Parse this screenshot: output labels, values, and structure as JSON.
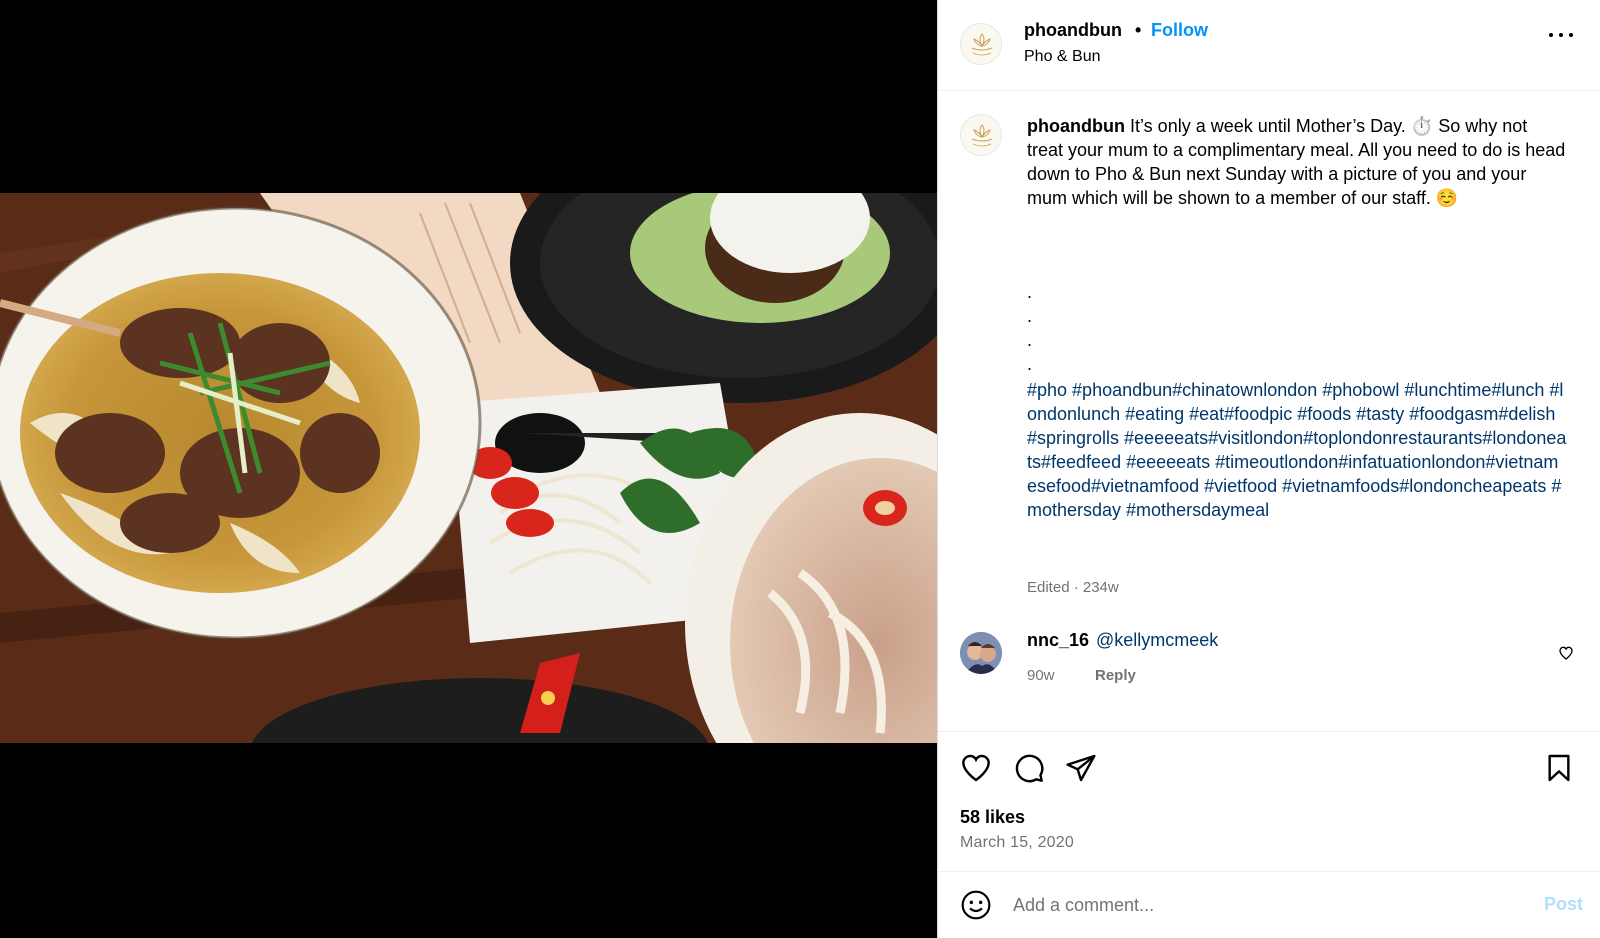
{
  "post": {
    "username": "phoandbun",
    "dot": "•",
    "follow_label": "Follow",
    "location": "Pho & Bun",
    "more_icon": "more-horizontal-icon"
  },
  "caption": {
    "username": "phoandbun",
    "text": "It’s only a week until Mother’s Day. ⏱️ So why not treat your mum to a complimentary meal. All you need to do is head down to Pho & Bun next Sunday with a picture of you and your mum which will be shown to a member of our staff. ☺️",
    "dots": [
      ".",
      ".",
      ".",
      "."
    ],
    "hashtags": "#pho #phoandbun#chinatownlondon #phobowl #lunchtime#lunch #londonlunch #eating #eat#foodpic #foods #tasty #foodgasm#delish #springrolls #eeeeeats#visitlondon#toplondonrestaurants#londoneats#feedfeed #eeeeeats #timeoutlondon#infatuationlondon#vietnamesefood#vietnamfood #vietfood #vietnamfoods#londoncheapeats #mothersday #mothersdaymeal",
    "meta": "Edited · 234w"
  },
  "comments": [
    {
      "username": "nnc_16",
      "text": "@kellymcmeek",
      "age": "90w",
      "reply_label": "Reply"
    }
  ],
  "actions": {
    "likes": "58 likes",
    "date": "March 15, 2020"
  },
  "add_comment": {
    "placeholder": "Add a comment...",
    "post_label": "Post"
  },
  "colors": {
    "link_blue": "#0095f6",
    "hashtag_blue": "#00376b",
    "muted": "#737373",
    "post_disabled": "#b2dffc"
  }
}
